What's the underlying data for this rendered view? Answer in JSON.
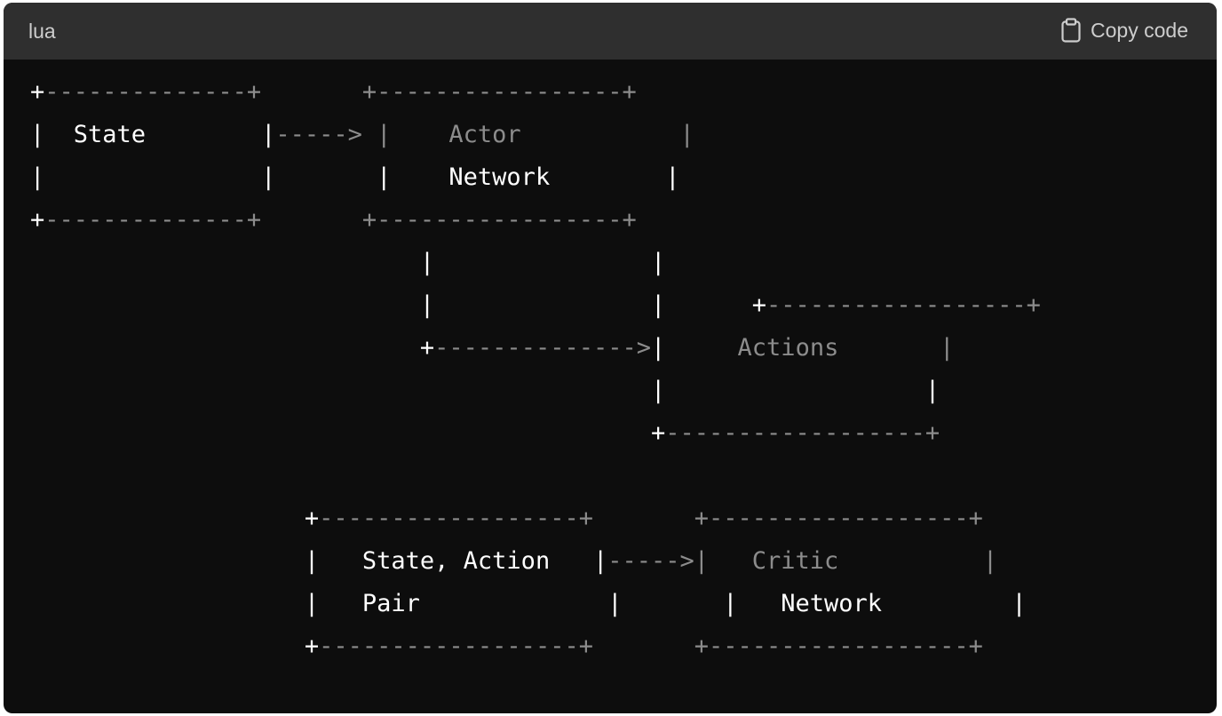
{
  "header": {
    "language": "lua",
    "copy_label": "Copy code"
  },
  "code": {
    "lines": [
      [
        {
          "t": "+",
          "c": "w"
        },
        {
          "t": "--------------+       +-----------------+",
          "c": "g"
        }
      ],
      [
        {
          "t": "|  State        |",
          "c": "w"
        },
        {
          "t": "-----> |    Actor           |",
          "c": "g"
        }
      ],
      [
        {
          "t": "|               |       |    Network        |",
          "c": "w"
        }
      ],
      [
        {
          "t": "+",
          "c": "w"
        },
        {
          "t": "--------------+       +-----------------+",
          "c": "g"
        }
      ],
      [
        {
          "t": "                           |               |",
          "c": "w"
        }
      ],
      [
        {
          "t": "                           |               |      ",
          "c": "w"
        },
        {
          "t": "+",
          "c": "w"
        },
        {
          "t": "------------------+",
          "c": "g"
        }
      ],
      [
        {
          "t": "                           +",
          "c": "w"
        },
        {
          "t": "-------------->",
          "c": "g"
        },
        {
          "t": "|",
          "c": "w"
        },
        {
          "t": "     Actions       |",
          "c": "g"
        }
      ],
      [
        {
          "t": "                                           |                  |",
          "c": "w"
        }
      ],
      [
        {
          "t": "                                           +",
          "c": "w"
        },
        {
          "t": "------------------+",
          "c": "g"
        }
      ],
      [
        {
          "t": "",
          "c": "w"
        }
      ],
      [
        {
          "t": "                   +",
          "c": "w"
        },
        {
          "t": "------------------+       +------------------+",
          "c": "g"
        }
      ],
      [
        {
          "t": "                   |   State, Action   |",
          "c": "w"
        },
        {
          "t": "----->|   Critic          |",
          "c": "g"
        }
      ],
      [
        {
          "t": "                   |   Pair             |       |   Network         |",
          "c": "w"
        }
      ],
      [
        {
          "t": "                   +",
          "c": "w"
        },
        {
          "t": "------------------+       +------------------+",
          "c": "g"
        }
      ]
    ]
  }
}
